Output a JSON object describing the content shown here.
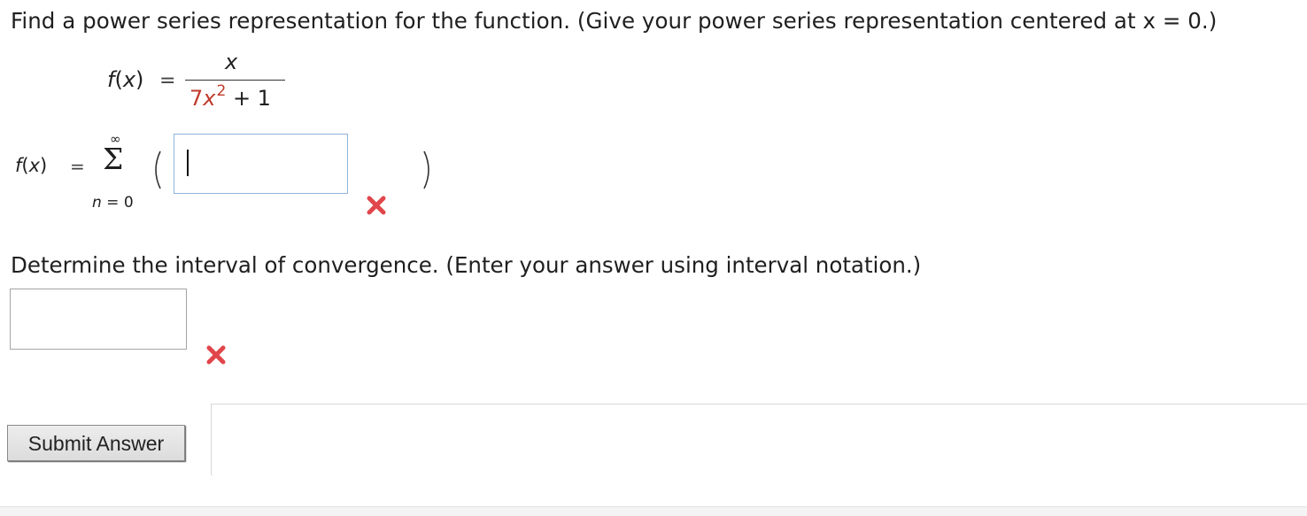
{
  "question": {
    "prompt": "Find a power series representation for the function. (Give your power series representation centered at x = 0.)"
  },
  "function_def": {
    "lhs": "f(x)",
    "equals": "=",
    "numerator": "x",
    "denominator_coefficient": "7",
    "denominator_base": "x",
    "denominator_exponent": "2",
    "denominator_tail": " + 1"
  },
  "series": {
    "lhs": "f(x)",
    "equals": "=",
    "upper_limit": "∞",
    "sigma": "Σ",
    "lower_limit": "n = 0",
    "input_value": ""
  },
  "convergence": {
    "prompt": "Determine the interval of convergence. (Enter your answer using interval notation.)",
    "input_value": ""
  },
  "status": {
    "series_answer": "incorrect",
    "interval_answer": "incorrect",
    "incorrect_color": "#e0464b"
  },
  "actions": {
    "submit_label": "Submit Answer"
  }
}
